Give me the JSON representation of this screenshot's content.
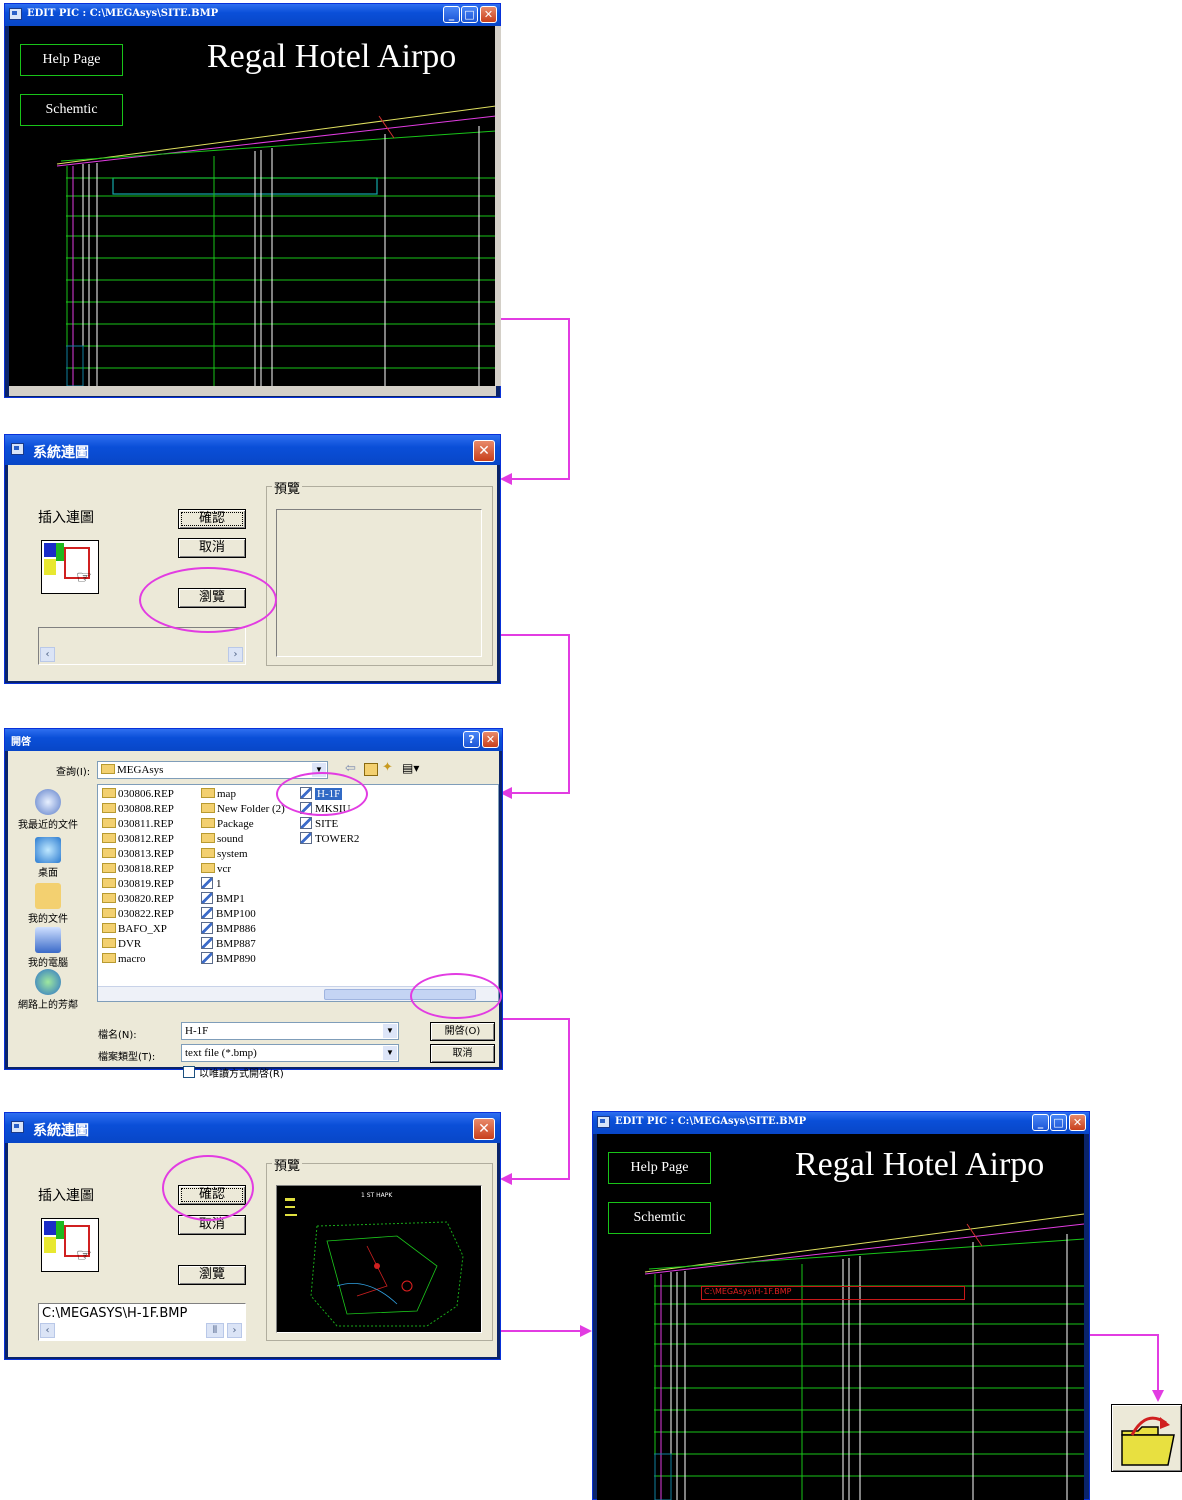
{
  "edit_window_top": {
    "title": "EDIT PIC : C:\\MEGAsys\\SITE.BMP",
    "help_button": "Help Page",
    "schematic_button": "Schemtic",
    "hotel_title": "Regal Hotel Airpo"
  },
  "insert_dialog_1": {
    "title": "系統連圖",
    "insert_label": "插入連圖",
    "confirm_label": "確認",
    "cancel_label": "取消",
    "browse_label": "瀏覽",
    "preview_label": "預覽",
    "path_value": ""
  },
  "open_dialog": {
    "title": "開啓",
    "lookin_label": "查詢(I):",
    "lookin_value": "MEGAsys",
    "places": [
      {
        "label": "我最近的文件",
        "icon": "recent-documents-icon"
      },
      {
        "label": "桌面",
        "icon": "desktop-icon"
      },
      {
        "label": "我的文件",
        "icon": "my-documents-icon"
      },
      {
        "label": "我的電腦",
        "icon": "my-computer-icon"
      },
      {
        "label": "網路上的芳鄰",
        "icon": "network-places-icon"
      }
    ],
    "col1": [
      "030806.REP",
      "030808.REP",
      "030811.REP",
      "030812.REP",
      "030813.REP",
      "030818.REP",
      "030819.REP",
      "030820.REP",
      "030822.REP",
      "BAFO_XP",
      "DVR",
      "macro"
    ],
    "col2_folders": [
      "map",
      "New Folder (2)",
      "Package",
      "sound",
      "system",
      "vcr"
    ],
    "col2_files": [
      "1",
      "BMP1",
      "BMP100",
      "BMP886",
      "BMP887",
      "BMP890"
    ],
    "col3": [
      "H-1F",
      "MKSIU",
      "SITE",
      "TOWER2"
    ],
    "filename_label": "檔名(N):",
    "filename_value": "H-1F",
    "filetype_label": "檔案類型(T):",
    "filetype_value": "text file (*.bmp)",
    "readonly_label": "以唯讀方式開啓(R)",
    "open_button": "開啓(O)",
    "cancel_button": "取消"
  },
  "insert_dialog_2": {
    "title": "系統連圖",
    "insert_label": "插入連圖",
    "confirm_label": "確認",
    "cancel_label": "取消",
    "browse_label": "瀏覽",
    "preview_label": "預覽",
    "path_value": "C:\\MEGASYS\\H-1F.BMP",
    "preview_caption": "1 ST HAPK"
  },
  "edit_window_bottom": {
    "title": "EDIT PIC : C:\\MEGAsys\\SITE.BMP",
    "help_button": "Help Page",
    "schematic_button": "Schemtic",
    "hotel_title": "Regal Hotel Airpo",
    "link_text": "C:\\MEGAsys\\H-1F.BMP"
  },
  "colors": {
    "accent": "#e23ce2",
    "cad_green": "#19c419",
    "dialog_bg": "#ece9d8"
  }
}
